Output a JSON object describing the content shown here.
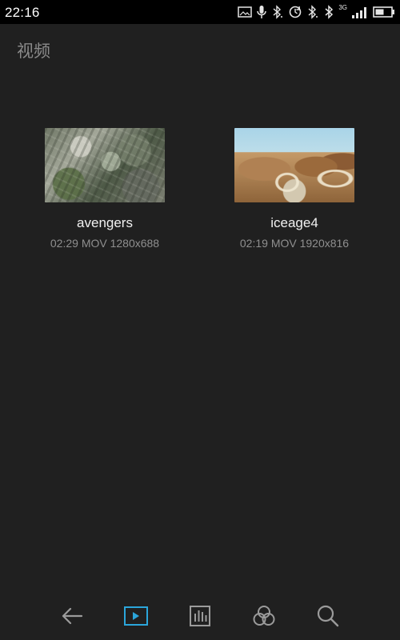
{
  "status_bar": {
    "time": "22:16",
    "network_label": "3G",
    "icons": [
      "image-icon",
      "microphone-icon",
      "bluetooth-icon",
      "sync-icon",
      "bluetooth-icon",
      "bluetooth-icon",
      "signal-icon",
      "battery-icon"
    ]
  },
  "header": {
    "title": "视频"
  },
  "videos": [
    {
      "title": "avengers",
      "meta": "02:29 MOV 1280x688"
    },
    {
      "title": "iceage4",
      "meta": "02:19 MOV 1920x816"
    }
  ],
  "bottom_nav": {
    "active": "video",
    "icons": [
      "back-arrow-icon",
      "video-play-icon",
      "music-bars-icon",
      "effects-circles-icon",
      "search-icon"
    ],
    "active_color": "#2BA6DB",
    "inactive_color": "#9B9B9B"
  }
}
